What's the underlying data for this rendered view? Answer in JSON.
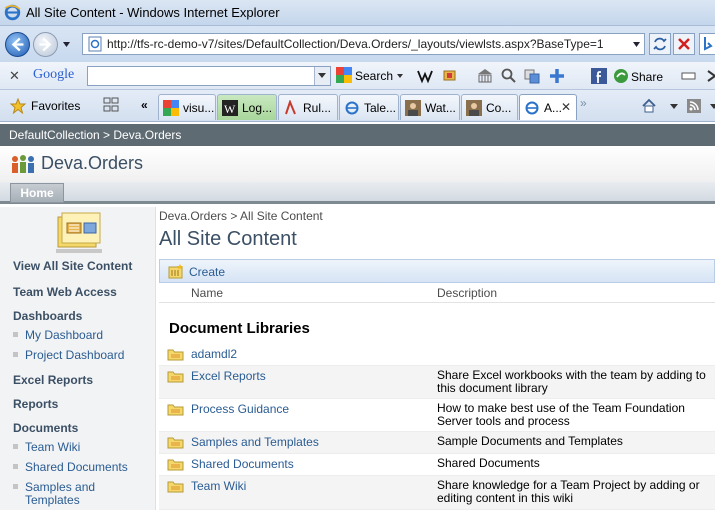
{
  "window": {
    "title": "All Site Content - Windows Internet Explorer"
  },
  "address_bar": {
    "url": "http://tfs-rc-demo-v7/sites/DefaultCollection/Deva.Orders/_layouts/viewlsts.aspx?BaseType=1"
  },
  "google_toolbar": {
    "logo": "Google",
    "close": "✕",
    "search_label": "Search",
    "share_label": "Share"
  },
  "favorites": {
    "label": "Favorites",
    "more": "«",
    "tabs": [
      {
        "label": "visu..."
      },
      {
        "label": "Log..."
      },
      {
        "label": "Rul..."
      },
      {
        "label": "Tale..."
      },
      {
        "label": "Wat..."
      },
      {
        "label": "Co..."
      },
      {
        "label": "A...",
        "active": true
      }
    ],
    "new_tab": "»"
  },
  "sharepoint": {
    "top_breadcrumb": "DefaultCollection > Deva.Orders",
    "site_title": "Deva.Orders",
    "home_tab": "Home",
    "quick_launch": {
      "view_all": "View All Site Content",
      "team_web_access": "Team Web Access",
      "dashboards": "Dashboards",
      "my_dashboard": "My Dashboard",
      "project_dashboard": "Project Dashboard",
      "excel_reports": "Excel Reports",
      "reports": "Reports",
      "documents": "Documents",
      "team_wiki": "Team Wiki",
      "shared_documents": "Shared Documents",
      "samples_line1": "Samples and",
      "samples_line2": "Templates"
    },
    "page_breadcrumb": "Deva.Orders > All Site Content",
    "page_title": "All Site Content",
    "create_label": "Create",
    "columns": {
      "name": "Name",
      "description": "Description"
    },
    "section_title": "Document Libraries",
    "libraries": [
      {
        "name": "adamdl2",
        "description": ""
      },
      {
        "name": "Excel Reports",
        "description": "Share Excel workbooks with the team by adding to this document library"
      },
      {
        "name": "Process Guidance",
        "description": "How to make best use of the Team Foundation Server tools and process"
      },
      {
        "name": "Samples and Templates",
        "description": "Sample Documents and Templates"
      },
      {
        "name": "Shared Documents",
        "description": "Shared Documents"
      },
      {
        "name": "Team Wiki",
        "description": "Share knowledge for a Team Project by adding or editing content in this wiki"
      }
    ]
  },
  "colors": {
    "sp_title": "#3b4f65",
    "link": "#2a5c93",
    "breadcrumb_bar": "#5f6b73"
  }
}
